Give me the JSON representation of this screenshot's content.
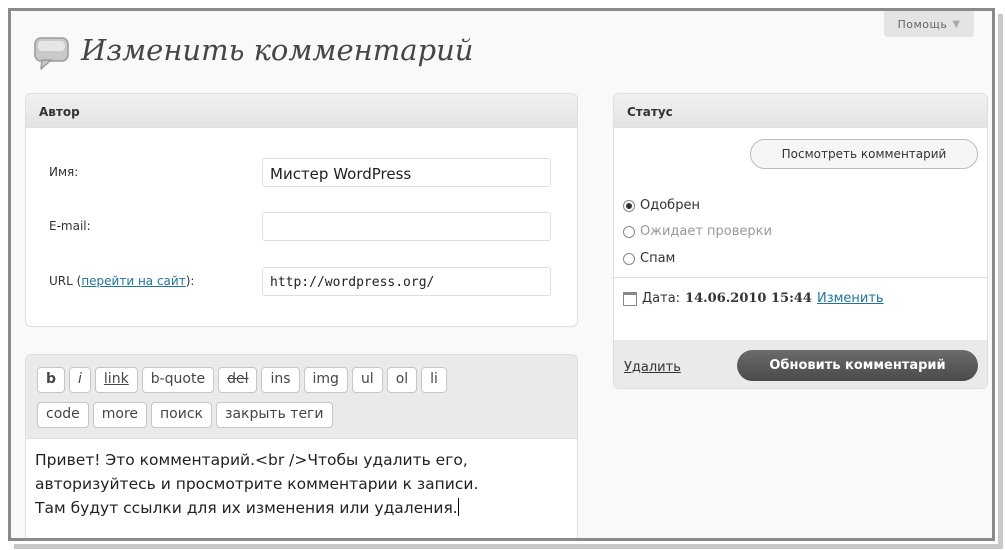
{
  "help": {
    "label": "Помощь"
  },
  "page": {
    "title": "Изменить комментарий"
  },
  "author": {
    "heading": "Автор",
    "name_label": "Имя:",
    "name_value": "Мистер WordPress",
    "email_label": "E-mail:",
    "email_value": "",
    "url_label_prefix": "URL (",
    "url_link": "перейти на сайт",
    "url_label_suffix": "):",
    "url_value": "http://wordpress.org/"
  },
  "editor": {
    "buttons_row1": [
      "b",
      "i",
      "link",
      "b-quote",
      "del",
      "ins",
      "img",
      "ul",
      "ol",
      "li"
    ],
    "buttons_row2": [
      "code",
      "more",
      "поиск",
      "закрыть теги"
    ],
    "content_lines": [
      "Привет! Это комментарий.<br />Чтобы удалить его,",
      "авторизуйтесь и просмотрите комментарии к записи.",
      "Там будут ссылки для их изменения или удаления."
    ]
  },
  "status": {
    "heading": "Статус",
    "view_button": "Посмотреть комментарий",
    "options": [
      {
        "label": "Одобрен",
        "checked": true,
        "dim": false
      },
      {
        "label": "Ожидает проверки",
        "checked": false,
        "dim": true
      },
      {
        "label": "Спам",
        "checked": false,
        "dim": false
      }
    ],
    "date_label": "Дата:",
    "date_value": "14.06.2010 15:44",
    "date_edit": "Изменить",
    "delete_link": "Удалить",
    "update_button": "Обновить комментарий"
  }
}
